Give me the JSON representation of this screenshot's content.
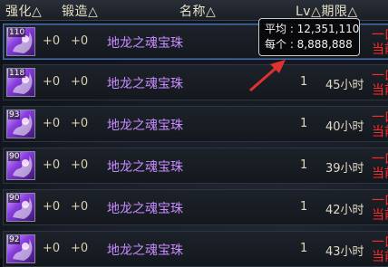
{
  "header": {
    "strengthen": "强化△",
    "forge": "锻造△",
    "name": "名称△",
    "lv_limit": "Lv△期限△"
  },
  "tooltip": {
    "avg_label": "平均 : 12,351,110",
    "each_label": "每个 : 8,888,888"
  },
  "rows": [
    {
      "icon_level": "110",
      "strengthen": "+0",
      "forge": "+0",
      "name": "地龙之魂宝珠",
      "count": "",
      "duration": "",
      "limit_top": "一口",
      "limit_bottom": "当前"
    },
    {
      "icon_level": "118",
      "strengthen": "+0",
      "forge": "+0",
      "name": "地龙之魂宝珠",
      "count": "1",
      "duration": "45小时",
      "limit_top": "一口",
      "limit_bottom": "当前"
    },
    {
      "icon_level": "93",
      "strengthen": "+0",
      "forge": "+0",
      "name": "地龙之魂宝珠",
      "count": "1",
      "duration": "40小时",
      "limit_top": "一口",
      "limit_bottom": "当前"
    },
    {
      "icon_level": "90",
      "strengthen": "+0",
      "forge": "+0",
      "name": "地龙之魂宝珠",
      "count": "1",
      "duration": "39小时",
      "limit_top": "一口",
      "limit_bottom": "当前"
    },
    {
      "icon_level": "90",
      "strengthen": "+0",
      "forge": "+0",
      "name": "地龙之魂宝珠",
      "count": "1",
      "duration": "42小时",
      "limit_top": "一口",
      "limit_bottom": "当前"
    },
    {
      "icon_level": "92",
      "strengthen": "+0",
      "forge": "+0",
      "name": "地龙之魂宝珠",
      "count": "1",
      "duration": "43小时",
      "limit_top": "一口",
      "limit_bottom": "当前"
    }
  ],
  "colors": {
    "name": "#c78bff",
    "limit": "#ff2a2a",
    "arrow": "#e03030"
  }
}
